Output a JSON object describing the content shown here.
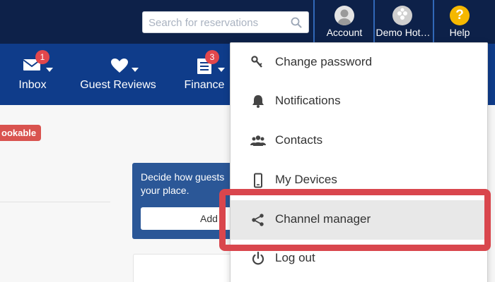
{
  "search": {
    "placeholder": "Search for reservations",
    "icon": "search-icon"
  },
  "topnav": {
    "account": {
      "label": "Account",
      "icon": "user-avatar"
    },
    "hotel": {
      "label": "Demo Hot…",
      "icon": "hotel-logo"
    },
    "help": {
      "label": "Help",
      "icon": "question-icon",
      "symbol": "?"
    }
  },
  "mainnav": {
    "items": [
      {
        "label": "Inbox",
        "icon": "envelope-icon",
        "badge": "1"
      },
      {
        "label": "Guest Reviews",
        "icon": "heart-icon"
      },
      {
        "label": "Finance",
        "icon": "ledger-icon",
        "badge": "3"
      }
    ]
  },
  "content": {
    "status_badge": "ookable",
    "promo_text": "Decide how guests your place.",
    "promo_button": "Add"
  },
  "dropdown": {
    "items": [
      {
        "label": "Change password",
        "icon": "key-icon"
      },
      {
        "label": "Notifications",
        "icon": "bell-icon"
      },
      {
        "label": "Contacts",
        "icon": "contacts-icon"
      },
      {
        "label": "My Devices",
        "icon": "mobile-icon"
      },
      {
        "label": "Channel manager",
        "icon": "share-icon",
        "active": true
      },
      {
        "label": "Log out",
        "icon": "power-icon"
      }
    ]
  },
  "colors": {
    "topbar": "#0d2149",
    "navbar": "#0f3c8a",
    "badge": "#e2474c",
    "highlight": "#d9464d",
    "help": "#f5b800"
  }
}
